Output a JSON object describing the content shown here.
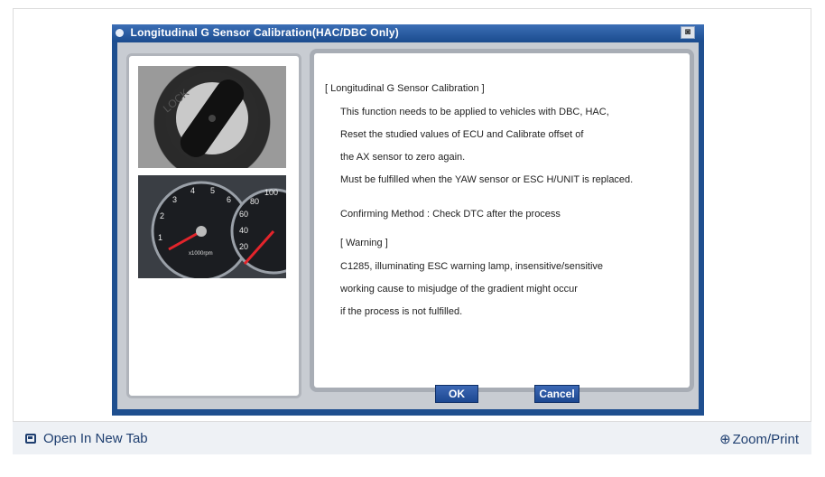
{
  "dialog": {
    "title": "Longitudinal G Sensor Calibration(HAC/DBC Only)",
    "lines": [
      "[ Longitudinal G Sensor Calibration ]",
      "This function needs to be applied to vehicles with DBC, HAC,",
      "Reset the studied values of ECU and Calibrate offset of",
      "the AX sensor to zero again.",
      "Must be fulfilled when the YAW sensor or ESC H/UNIT is replaced.",
      "Confirming Method : Check DTC after the process",
      "[ Warning ]",
      "C1285, illuminating ESC warning lamp, insensitive/sensitive",
      "working cause to misjudge of the gradient might occur",
      "if the process is not fulfilled."
    ],
    "ok_label": "OK",
    "cancel_label": "Cancel",
    "photo_key_text": "LOCK",
    "photo_gauge_unit": "x1000rpm",
    "gauge_ticks": [
      "1",
      "2",
      "3",
      "4",
      "5",
      "6",
      "20",
      "40",
      "60",
      "80",
      "100"
    ]
  },
  "footer": {
    "open_new_tab": "Open In New Tab",
    "zoom_print": "Zoom/Print"
  },
  "icons": {
    "title_icon": "bullet-icon",
    "window_button": "camera-icon",
    "new_tab": "open-new-tab-icon",
    "zoom": "zoom-in-icon"
  },
  "colors": {
    "dialog_blue": "#1f4f8f",
    "button_blue": "#2a57a3",
    "link": "#1f3f70"
  }
}
